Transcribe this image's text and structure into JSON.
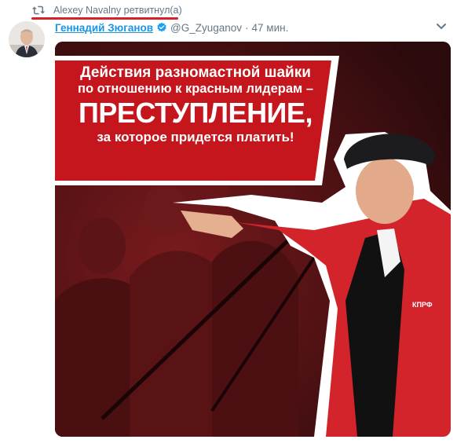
{
  "retweet": {
    "text": "Alexey Navalny ретвитнул(а)",
    "icon": "retweet-icon",
    "underline_color": "#d8212b"
  },
  "tweet": {
    "display_name": "Геннадий Зюганов",
    "handle": "@G_Zyuganov",
    "separator": "·",
    "time": "47 мин.",
    "verified_icon": "verified-badge-icon",
    "menu_icon": "chevron-down-icon",
    "name_color": "#1b95e0"
  },
  "media": {
    "banner_lines": [
      "Действия разномастной шайки",
      "по отношению к красным лидерам –",
      "ПРЕСТУПЛЕНИЕ,",
      "за которое придется платить!"
    ],
    "banner_color": "#c4161c",
    "jacket_emblem": "КПРФ"
  }
}
